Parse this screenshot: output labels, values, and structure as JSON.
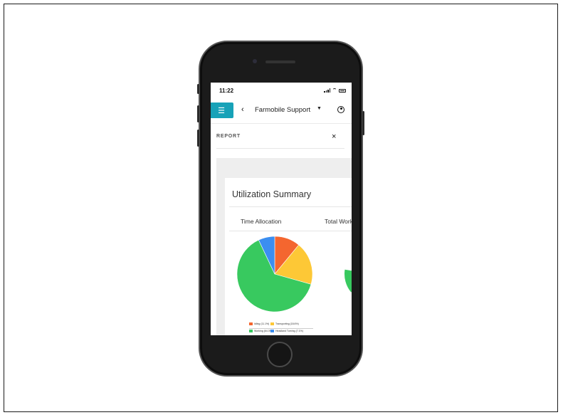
{
  "status_bar": {
    "time": "11:22"
  },
  "nav": {
    "menu_icon": "hamburger-icon",
    "back_icon": "chevron-left-icon",
    "org_name": "Farmobile Support",
    "dropdown_icon": "caret-down-icon",
    "account_icon": "user-circle-icon"
  },
  "panel": {
    "title": "REPORT",
    "close_label": "×"
  },
  "card": {
    "title": "Utilization Summary",
    "tabs": [
      "Time Allocation",
      "Total Work"
    ]
  },
  "chart_data": {
    "type": "pie",
    "slices": [
      {
        "label": "Idling (11.1%)",
        "value": 11.1,
        "color": "#f4662f"
      },
      {
        "label": "Transporting (18.6%)",
        "value": 18.6,
        "color": "#fdc836"
      },
      {
        "label": "Working (64.3%)",
        "value": 64.3,
        "color": "#38c95f"
      },
      {
        "label": "Headland Turning (7.1%)",
        "value": 7.1,
        "color": "#3b8ef0"
      }
    ]
  },
  "colors": {
    "accent": "#17a2b8"
  }
}
